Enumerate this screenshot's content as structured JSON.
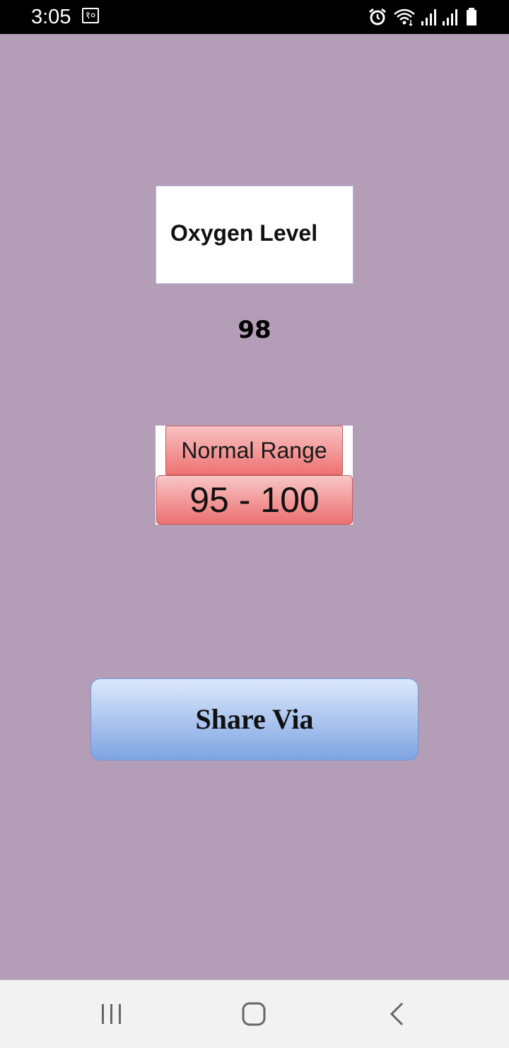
{
  "status_bar": {
    "time": "3:05",
    "notification_badge": "१०",
    "icons": [
      "alarm-icon",
      "wifi-icon",
      "signal-icon",
      "signal-icon-2",
      "battery-icon"
    ]
  },
  "main": {
    "label": "Oxygen Level",
    "value": "98",
    "normal_range": {
      "title": "Normal Range",
      "value": "95 - 100"
    },
    "share_button_label": "Share Via"
  },
  "navigation": {
    "buttons": [
      "recent-apps-icon",
      "home-icon",
      "back-icon"
    ]
  },
  "colors": {
    "background": "#b49eb7",
    "range_red": "#ee7272",
    "share_blue": "#7ea4e2"
  }
}
